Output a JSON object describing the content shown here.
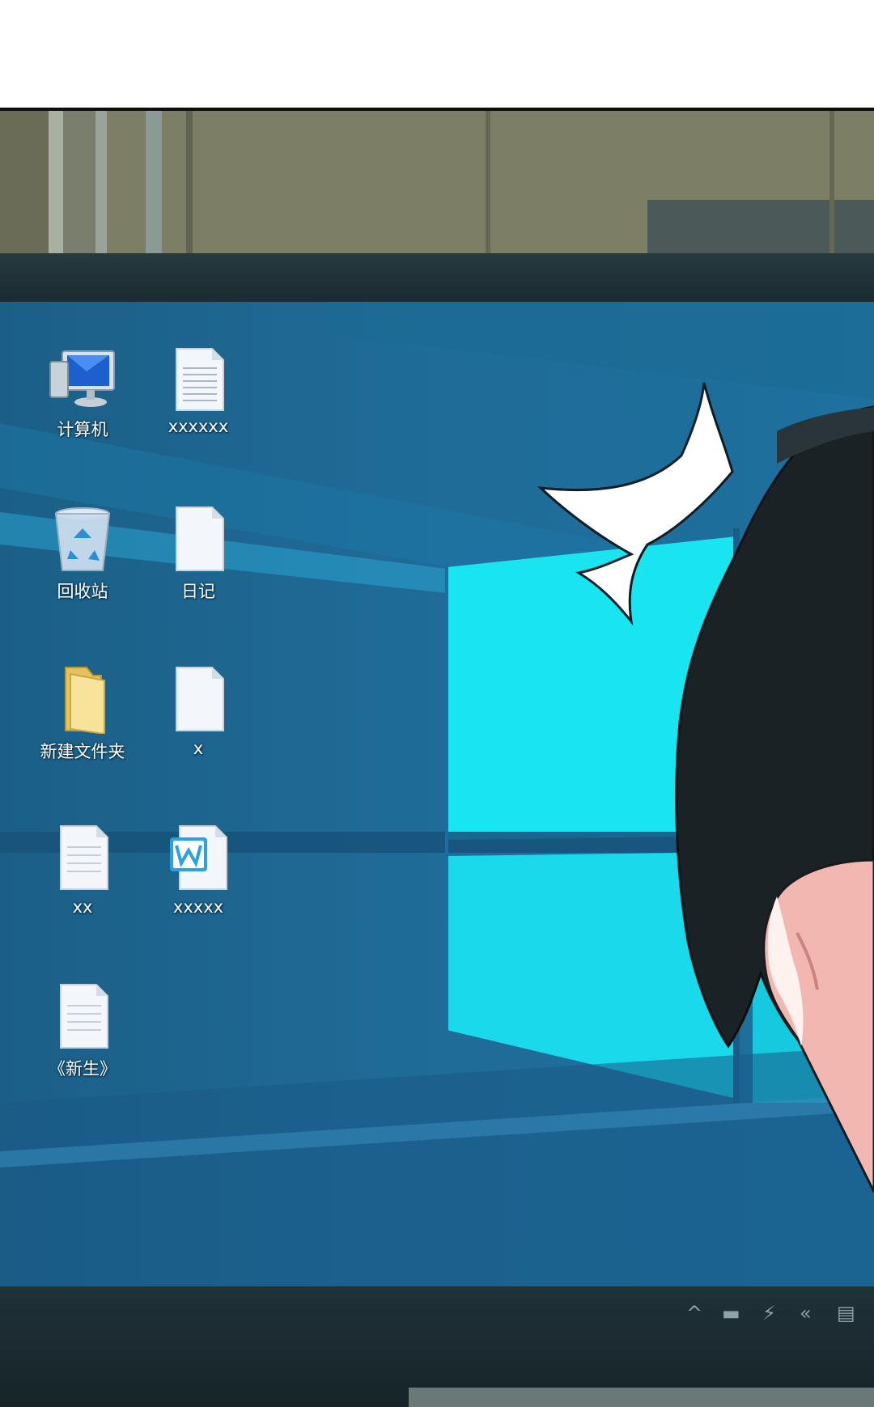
{
  "desktop": {
    "icons": [
      {
        "label": "计算机",
        "icon": "computer-icon"
      },
      {
        "label": "xxxxxx",
        "icon": "text-document-icon"
      },
      {
        "label": "回收站",
        "icon": "recycle-bin-icon"
      },
      {
        "label": "日记",
        "icon": "blank-document-icon"
      },
      {
        "label": "新建文件夹",
        "icon": "folder-icon"
      },
      {
        "label": "x",
        "icon": "blank-document-icon"
      },
      {
        "label": "xx",
        "icon": "text-document-icon"
      },
      {
        "label": "xxxxx",
        "icon": "word-document-icon"
      },
      {
        "label": "《新生》",
        "icon": "text-document-icon"
      }
    ]
  },
  "tray": {
    "icons": [
      "chevron-up-icon",
      "keyboard-icon",
      "network-icon",
      "volume-icon",
      "notification-icon"
    ],
    "glyphs": [
      "^",
      "▬",
      "⚡",
      "«",
      "▤"
    ]
  },
  "colors": {
    "screen": "#1f6b97",
    "window_light": "#19e5f0",
    "hair": "#1a2226",
    "skin": "#f2b7b0"
  }
}
